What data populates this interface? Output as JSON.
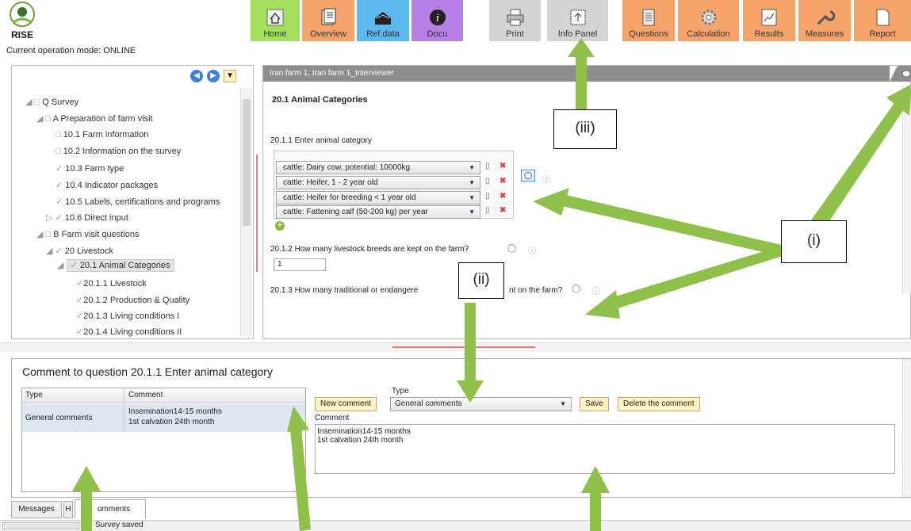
{
  "app": {
    "logo_text": "RISE",
    "mode_text": "Current operation mode: ONLINE"
  },
  "toolbar": {
    "home": "Home",
    "overview": "Overview",
    "refdata": "Ref.data",
    "docu": "Docu",
    "print": "Print",
    "infopanel": "Info Panel",
    "questions": "Questions",
    "calculation": "Calculation",
    "results": "Results",
    "measures": "Measures",
    "report": "Report"
  },
  "tree": {
    "items": [
      "Q Survey",
      "A Preparation of farm visit",
      "10.1 Farm information",
      "10.2 Information on the survey",
      "10.3 Farm type",
      "10.4 Indicator packages",
      "10.5 Labels, certifications and programs",
      "10.6 Direct input",
      "B Farm visit questions",
      "20 Livestock",
      "20.1 Animal Categories",
      "20.1.1 Livestock",
      "20.1.2 Production & Quality",
      "20.1.3 Living conditions I",
      "20.1.4 Living conditions II"
    ]
  },
  "main": {
    "header": "Iran farm 1, Iran farm 1_Interviewer",
    "section_title": "20.1  Animal Categories",
    "q1_label": "20.1.1 Enter animal category",
    "categories": [
      "cattle: Dairy cow, potential: 10000kg",
      "cattle: Heifer, 1 - 2 year old",
      "cattle: Heifer for breeding < 1 year old",
      "cattle: Fattening calf (50-200 kg) per year"
    ],
    "q2_label": "20.1.2 How many livestock breeds are kept on the farm?",
    "q2_value": "1",
    "q3_label": "20.1.3 How many traditional or endangere",
    "q3_tail": "nt on the farm?"
  },
  "comment_panel": {
    "title": "Comment to question 20.1.1 Enter animal category",
    "table_headers": [
      "Type",
      "Comment"
    ],
    "rows": [
      {
        "type": "General comments",
        "comment_line1": "Insemination14-15 months",
        "comment_line2": "1st calvation 24th month"
      }
    ],
    "type_label": "Type",
    "new_comment": "New comment",
    "type_value": "General comments",
    "save": "Save",
    "delete": "Delete the comment",
    "comment_label": "Comment",
    "comment_line1": "Insemination14-15 months",
    "comment_line2": "1st calvation 24th month"
  },
  "tabs": [
    "Messages",
    "H",
    "omments"
  ],
  "status": "Survey saved",
  "annotations": {
    "i": "(i)",
    "ii": "(ii)",
    "iii": "(iii)"
  },
  "colors": {
    "arrow": "#8fc04a",
    "accent_red": "#e08080"
  }
}
